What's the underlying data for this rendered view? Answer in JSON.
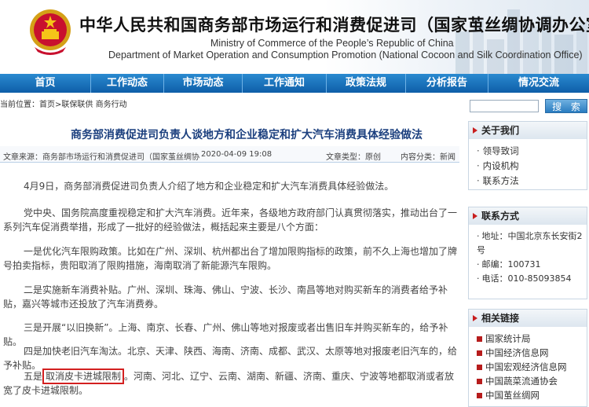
{
  "header": {
    "title_cn": "中华人民共和国商务部市场运行和消费促进司（国家茧丝绸协调办公室）",
    "title_en_1": "Ministry of Commerce of the People’s Republic of China",
    "title_en_2": "Department of Market Operation and Consumption Promotion (National Cocoon and Silk Coordination Office)"
  },
  "nav": {
    "items": [
      "首页",
      "工作动态",
      "市场动态",
      "工作通知",
      "政策法规",
      "分析报告",
      "情况交流"
    ]
  },
  "breadcrumb": {
    "label": "当前位置：",
    "items": [
      "首页",
      "联保联供",
      "商务行动"
    ]
  },
  "search": {
    "button_label": "搜 索",
    "value": ""
  },
  "article": {
    "title": "商务部消费促进司负责人谈地方和企业稳定和扩大汽车消费具体经验做法",
    "source": "文章来源：商务部市场运行和消费促进司（国家茧丝绸协",
    "date": "2020-04-09 19:08",
    "type": "文章类型：原创",
    "content_type": "内容分类：新闻",
    "paragraphs": [
      "4月9日，商务部消费促进司负责人介绍了地方和企业稳定和扩大汽车消费具体经验做法。",
      "党中央、国务院高度重视稳定和扩大汽车消费。近年来，各级地方政府部门认真贯彻落实，推动出台了一系列汽车促消费举措，形成了一批好的经验做法，概括起来主要是八个方面：",
      "一是优化汽车限购政策。比如在广州、深圳、杭州都出台了增加限购指标的政策，前不久上海也增加了牌号拍卖指标，贵阳取消了限购措施，海南取消了新能源汽车限购。",
      "二是实施新车消费补贴。广州、深圳、珠海、佛山、宁波、长沙、南昌等地对购买新车的消费者给予补贴，嘉兴等城市还投放了汽车消费券。",
      "三是开展“以旧换新”。上海、南京、长春、广州、佛山等地对报废或者出售旧车并购买新车的，给予补贴。",
      "四是加快老旧汽车淘汰。北京、天津、陕西、海南、济南、成都、武汉、太原等地对报废老旧汽车的，给予补贴。"
    ],
    "para5_prefix": "五是",
    "para5_highlight": "取消皮卡进城限制",
    "para5_suffix": "。河南、河北、辽宁、云南、湖南、新疆、济南、重庆、宁波等地都取消或者放宽了皮卡进城限制。"
  },
  "sidebar": {
    "about": {
      "title": "关于我们",
      "items": [
        "领导致词",
        "内设机构",
        "联系方法"
      ]
    },
    "contact": {
      "title": "联系方式",
      "address": "地址：中国北京东长安街2号",
      "postcode": "邮编：100731",
      "phone": "电话：010-85093854"
    },
    "links": {
      "title": "相关链接",
      "items": [
        "国家统计局",
        "中国经济信息网",
        "中国宏观经济信息网",
        "中国蔬菜流通协会",
        "中国茧丝绸网"
      ]
    }
  }
}
